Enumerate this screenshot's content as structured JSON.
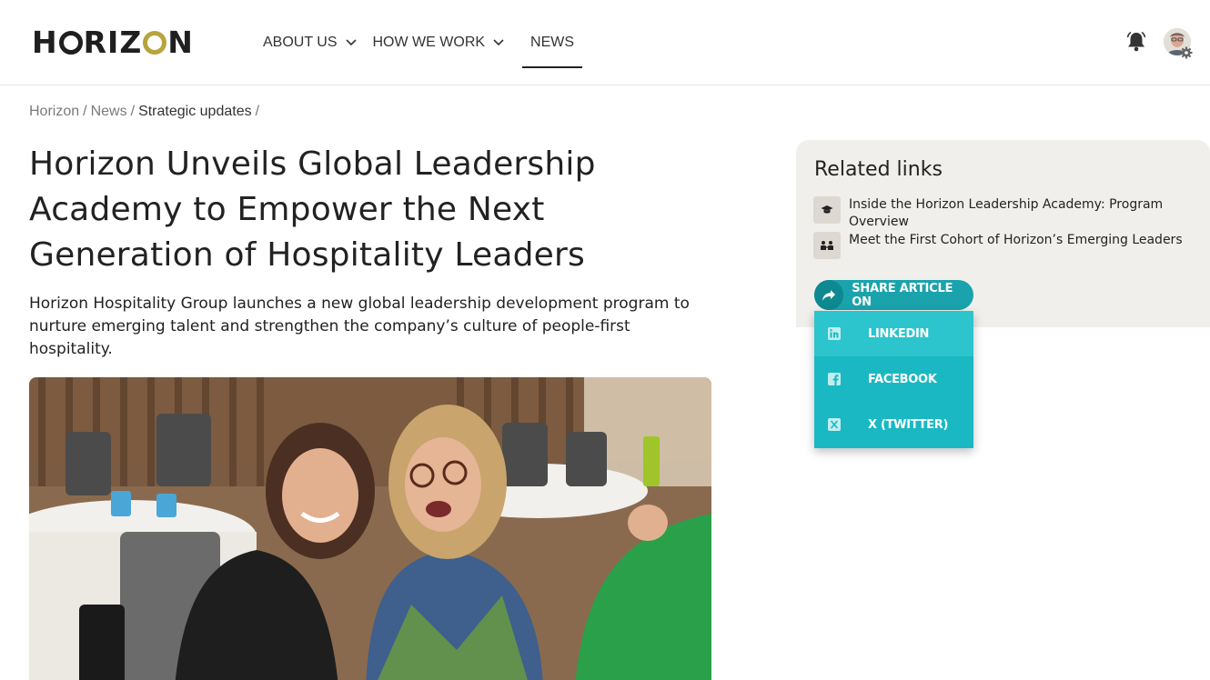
{
  "header": {
    "logo_text": "HORIZON",
    "nav": [
      {
        "label": "ABOUT US",
        "has_dropdown": true
      },
      {
        "label": "HOW WE WORK",
        "has_dropdown": true
      },
      {
        "label": "NEWS",
        "has_dropdown": false,
        "active": true
      }
    ],
    "icons": [
      "bell-icon",
      "avatar",
      "gear-icon"
    ]
  },
  "breadcrumb": {
    "items": [
      "Horizon",
      "News",
      "Strategic updates"
    ],
    "separator": "/"
  },
  "article": {
    "title": "Horizon Unveils Global Leadership Academy to Empower the Next Generation of Hospitality Leaders",
    "subtitle": "Horizon Hospitality Group launches a new global leadership development program to nurture emerging talent and strengthen the company’s culture of people-first hospitality."
  },
  "related": {
    "heading": "Related links",
    "links": [
      {
        "label": "Inside the Horizon Leadership Academy: Program Overview",
        "icon": "graduation-cap-icon"
      },
      {
        "label": "Meet the First Cohort of Horizon’s Emerging Leaders",
        "icon": "people-icon"
      }
    ]
  },
  "share": {
    "button_label": "SHARE ARTICLE ON",
    "options": [
      {
        "label": "LINKEDIN",
        "icon": "linkedin-icon"
      },
      {
        "label": "FACEBOOK",
        "icon": "facebook-icon"
      },
      {
        "label": "X (TWITTER)",
        "icon": "x-twitter-icon"
      }
    ]
  },
  "colors": {
    "accent": "#1aa3ad",
    "menu": "#1ab8c2",
    "logo_gold": "#b8a43c",
    "panel_bg": "#f1efeb"
  }
}
